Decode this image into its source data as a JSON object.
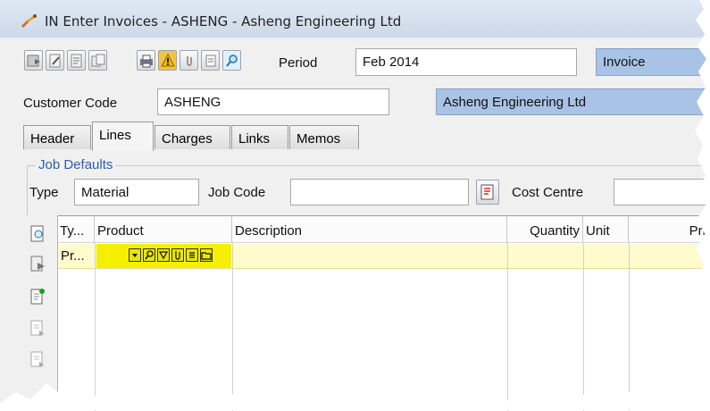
{
  "window": {
    "title": "IN Enter Invoices - ASHENG - Asheng Engineering Ltd"
  },
  "toolbar": {
    "icons": [
      "save-icon",
      "edit-icon",
      "new-doc-icon",
      "copy-icon",
      "print-icon",
      "warning-icon",
      "attach-icon",
      "notes-icon",
      "search-icon"
    ],
    "period_label": "Period",
    "period_value": "Feb 2014",
    "doc_type_value": "Invoice"
  },
  "customer": {
    "label": "Customer Code",
    "code": "ASHENG",
    "name": "Asheng Engineering Ltd"
  },
  "tabs": [
    {
      "label": "Header",
      "active": false
    },
    {
      "label": "Lines",
      "active": true
    },
    {
      "label": "Charges",
      "active": false
    },
    {
      "label": "Links",
      "active": false
    },
    {
      "label": "Memos",
      "active": false
    }
  ],
  "job_defaults": {
    "group_label": "Job Defaults",
    "type_label": "Type",
    "type_value": "Material",
    "job_code_label": "Job Code",
    "job_code_value": "",
    "cost_centre_label": "Cost Centre",
    "cost_centre_value": ""
  },
  "grid": {
    "columns": [
      "Ty...",
      "Product",
      "Description",
      "Quantity",
      "Unit",
      "Pri"
    ],
    "rows": [
      {
        "type": "Pr...",
        "product": "",
        "description": "",
        "quantity": "",
        "unit": "",
        "price": ""
      }
    ],
    "side_icons": [
      "lookup-icon",
      "edit-line-icon",
      "add-line-icon",
      "insert-line-icon",
      "delete-line-icon"
    ],
    "product_cell_icons": [
      "dropdown-icon",
      "search-icon",
      "filter-icon",
      "attach-icon",
      "notes-icon",
      "folder-icon"
    ]
  },
  "colors": {
    "row_highlight": "#fffbcc",
    "product_highlight": "#f5f000",
    "info_field": "#a9c3e6"
  }
}
